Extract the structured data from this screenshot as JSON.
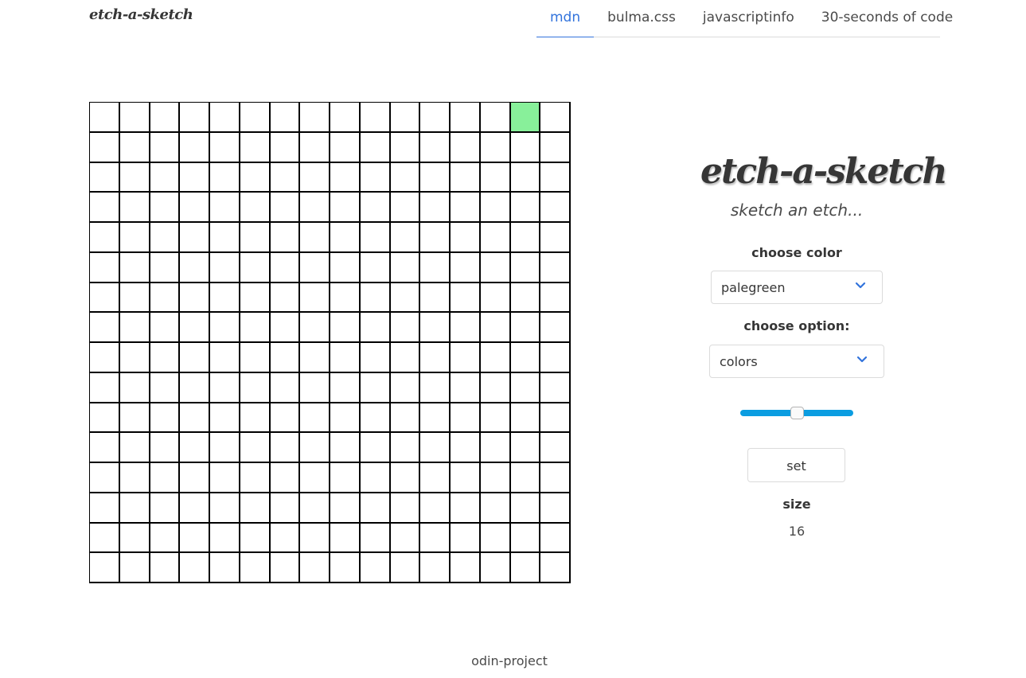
{
  "brand": "etch-a-sketch",
  "nav": {
    "tabs": [
      {
        "label": "mdn",
        "active": true
      },
      {
        "label": "bulma.css",
        "active": false
      },
      {
        "label": "javascriptinfo",
        "active": false
      },
      {
        "label": "30-seconds of code",
        "active": false
      }
    ]
  },
  "canvas": {
    "size": 16,
    "cell_color": "#ffffff",
    "painted": [
      {
        "row": 0,
        "col": 14,
        "color": "#88f09a"
      }
    ]
  },
  "panel": {
    "title": "etch-a-sketch",
    "subtitle": "sketch an etch...",
    "color_label": "choose color",
    "color_value": "palegreen",
    "option_label": "choose option:",
    "option_value": "colors",
    "slider_fraction": 0.5,
    "slider_color": "#0b9de1",
    "set_label": "set",
    "size_label": "size",
    "size_value": "16"
  },
  "footer": {
    "text": "odin-project"
  },
  "icons": {
    "dropdown": "chevron-down-icon"
  }
}
